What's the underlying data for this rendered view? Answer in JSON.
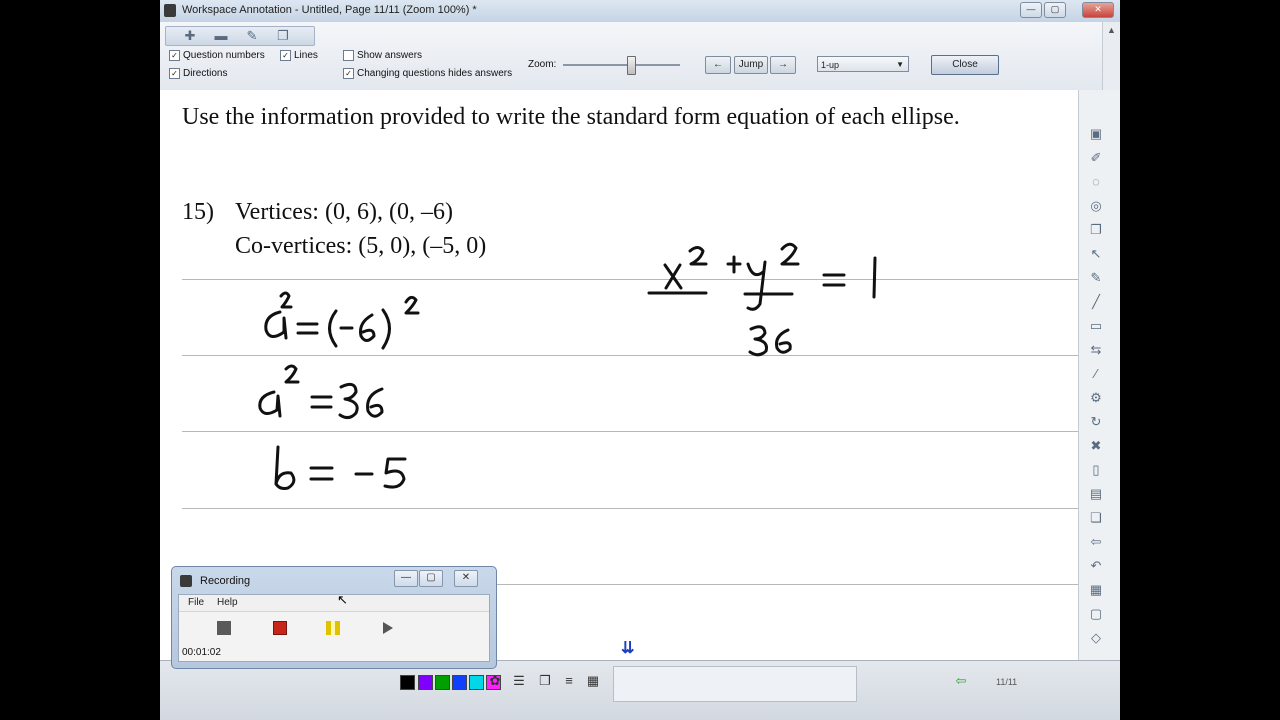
{
  "window": {
    "title": "Workspace Annotation - Untitled, Page 11/11 (Zoom 100%) *"
  },
  "window_controls": {
    "minimize": "—",
    "maximize": "▢",
    "close": "✕"
  },
  "toolbar": {
    "icons": [
      "plus-icon",
      "minus-icon",
      "edit-icon",
      "copy-icon"
    ],
    "checkboxes": {
      "question_numbers": "Question numbers",
      "directions": "Directions",
      "lines": "Lines",
      "show_answers": "Show answers",
      "changing_questions": "Changing questions hides answers"
    },
    "zoom_label": "Zoom:",
    "jump_label": "Jump",
    "back_label": "←",
    "forward_label": "→",
    "layout_select": "1-up",
    "close_label": "Close"
  },
  "page": {
    "instruction": "Use the information provided to write the standard form equation of each ellipse.",
    "question": {
      "number": "15)",
      "line1": "Vertices: (0, 6), (0, –6)",
      "line2": "Co-vertices: (5, 0), (–5, 0)"
    }
  },
  "recording": {
    "title": "Recording",
    "menu_file": "File",
    "menu_help": "Help",
    "elapsed": "00:01:02",
    "buttons": {
      "minimize": "—",
      "restore": "▢",
      "close": "✕"
    }
  },
  "bottom": {
    "colors": [
      "#000000",
      "#8000ff",
      "#00a000",
      "#1040ff",
      "#00d8e8",
      "#ff20ff"
    ],
    "page_indicator": "11/11"
  }
}
